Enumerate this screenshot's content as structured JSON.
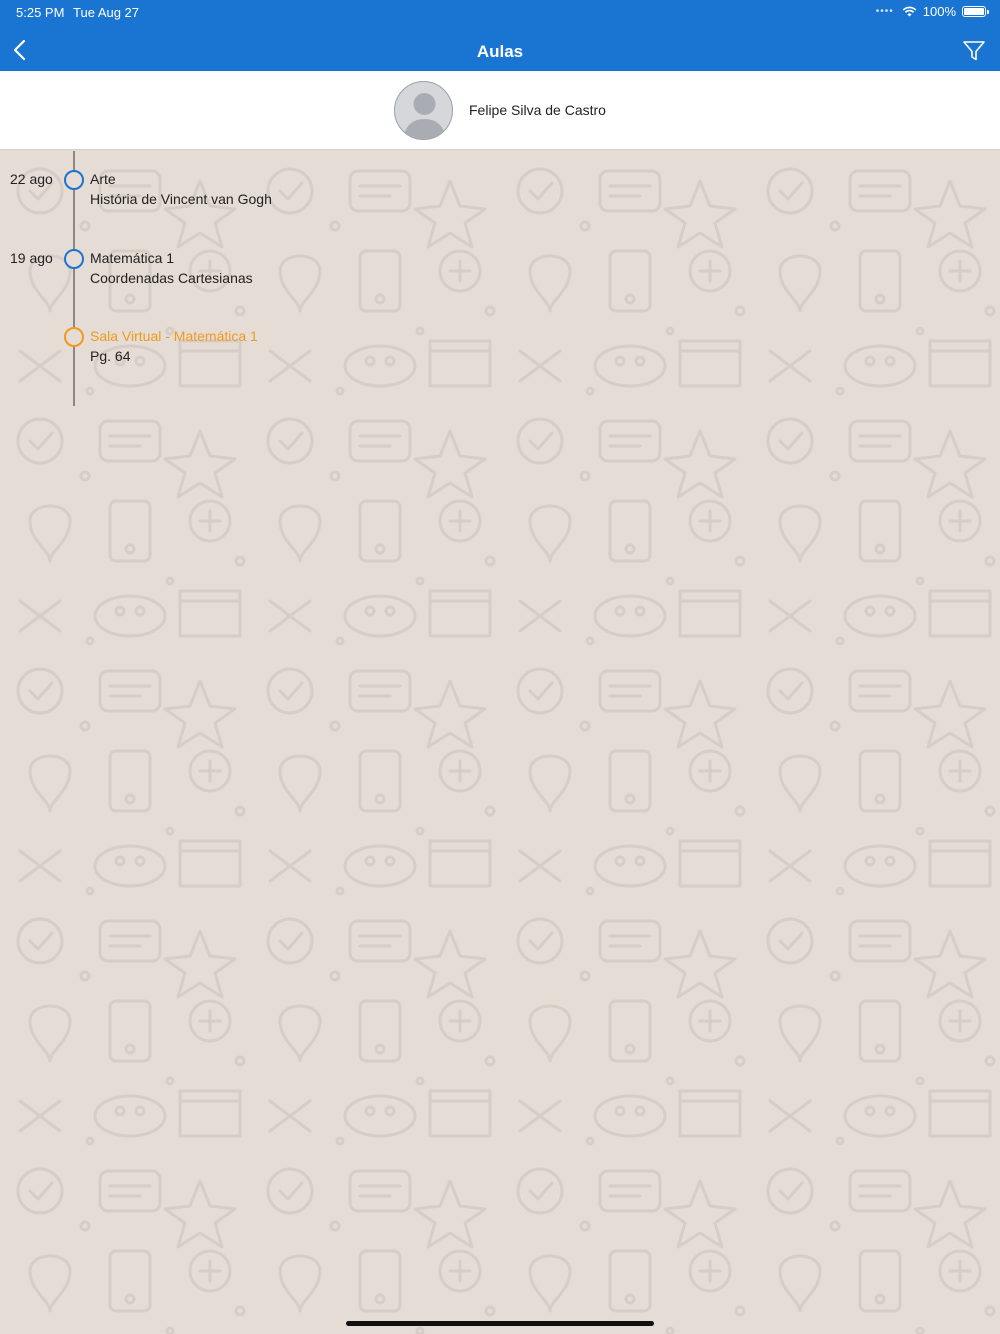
{
  "status_bar": {
    "time": "5:25 PM",
    "date": "Tue Aug 27",
    "battery": "100%",
    "icons": [
      "signal-dots-icon",
      "wifi-icon",
      "battery-icon"
    ]
  },
  "nav": {
    "title": "Aulas",
    "back_icon": "chevron-left-icon",
    "filter_icon": "filter-icon"
  },
  "profile": {
    "name": "Felipe Silva de Castro",
    "avatar_icon": "user-avatar-icon"
  },
  "timeline": {
    "items": [
      {
        "date": "22 ago",
        "title": "Arte",
        "subtitle": "História de Vincent van Gogh",
        "status_color": "#1a75d2"
      },
      {
        "date": "19 ago",
        "title": "Matemática 1",
        "subtitle": "Coordenadas Cartesianas",
        "status_color": "#1a75d2"
      },
      {
        "date": "",
        "title": "Sala Virtual - Matemática 1",
        "subtitle": "Pg. 64",
        "status_color": "#f09a1c"
      }
    ]
  },
  "colors": {
    "header": "#1a75d2",
    "background": "#e4dcd5",
    "accent_orange": "#f09a1c"
  }
}
